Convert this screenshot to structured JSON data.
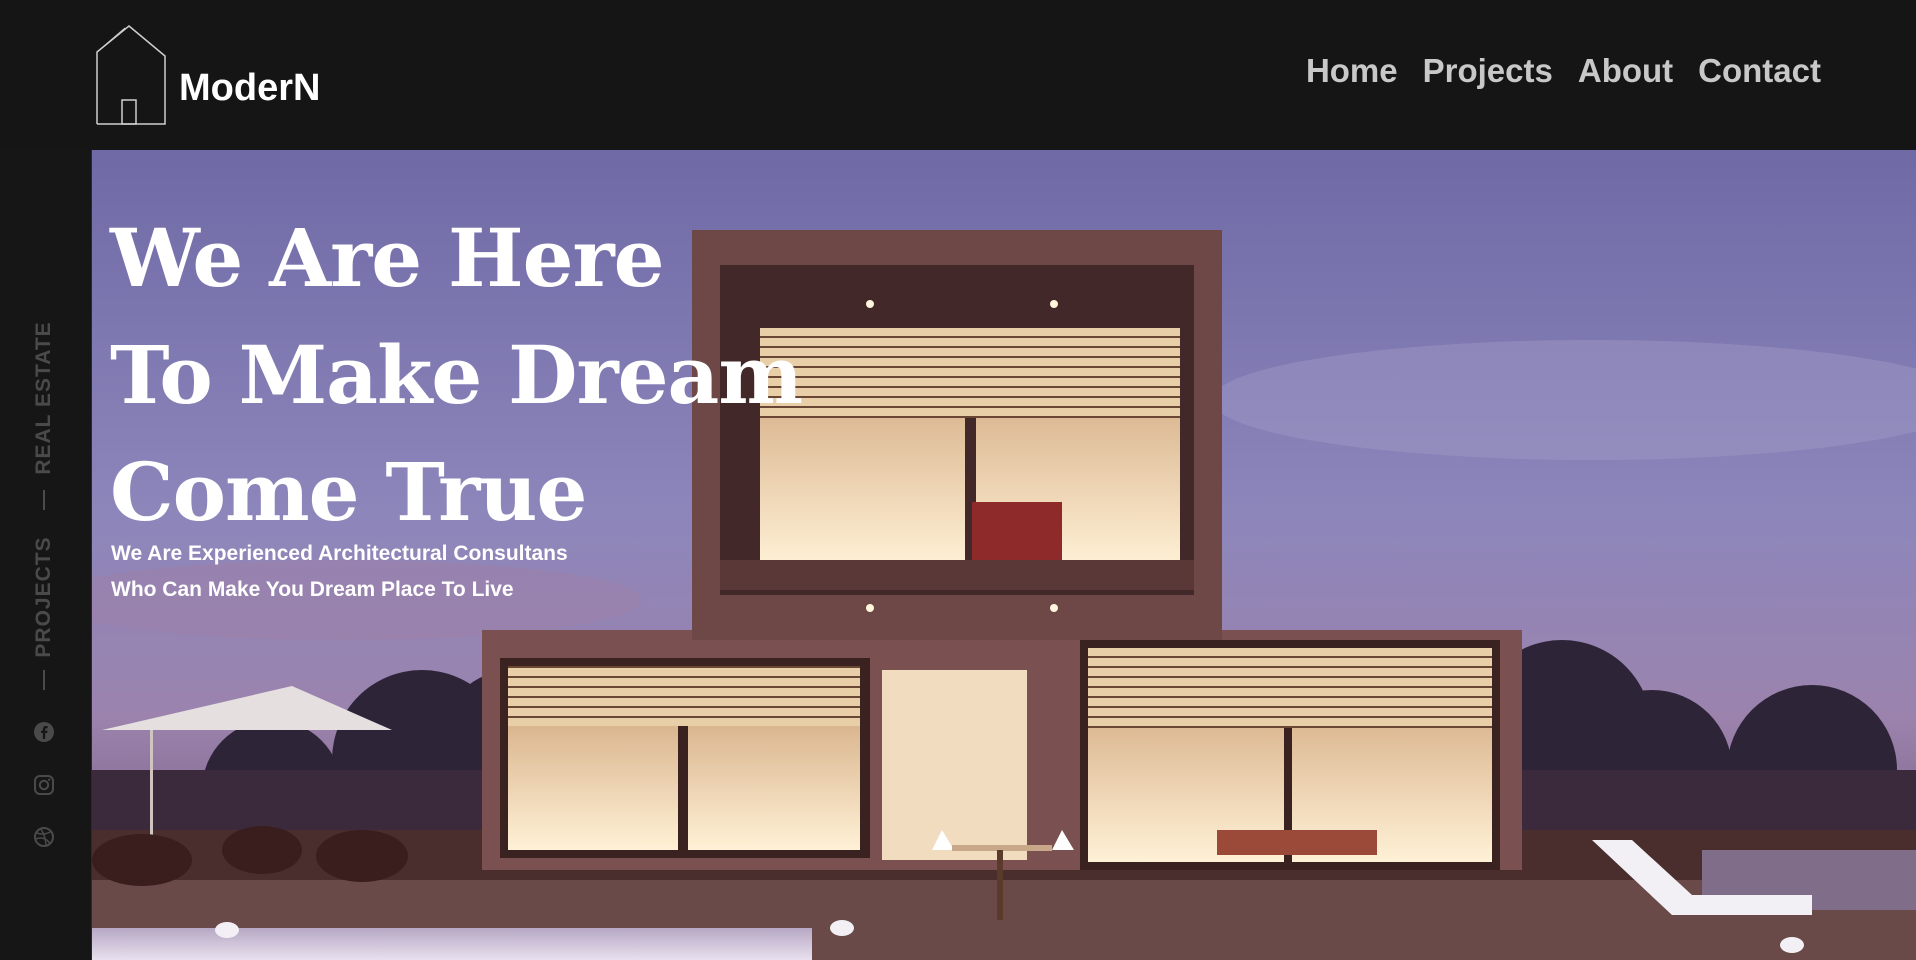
{
  "header": {
    "logo_text": "ModerN",
    "logo_icon": "house-outline-icon",
    "nav": [
      {
        "label": "Home"
      },
      {
        "label": "Projects"
      },
      {
        "label": "About"
      },
      {
        "label": "Contact"
      }
    ]
  },
  "sidebar": {
    "labels": [
      "REAL ESTATE",
      "PROJECTS"
    ],
    "social_icons": [
      "facebook-icon",
      "instagram-icon",
      "dribbble-icon"
    ]
  },
  "hero": {
    "headline": [
      "We Are Here",
      "To Make Dream",
      "Come True"
    ],
    "subtitle": [
      "We Are Experienced Architectural Consultans",
      "Who Can Make You Dream Place To Live"
    ]
  },
  "colors": {
    "background": "#151515",
    "nav_text": "#c8c8c8",
    "sidebar_text": "#4a4a4a",
    "headline": "#ffffff"
  }
}
